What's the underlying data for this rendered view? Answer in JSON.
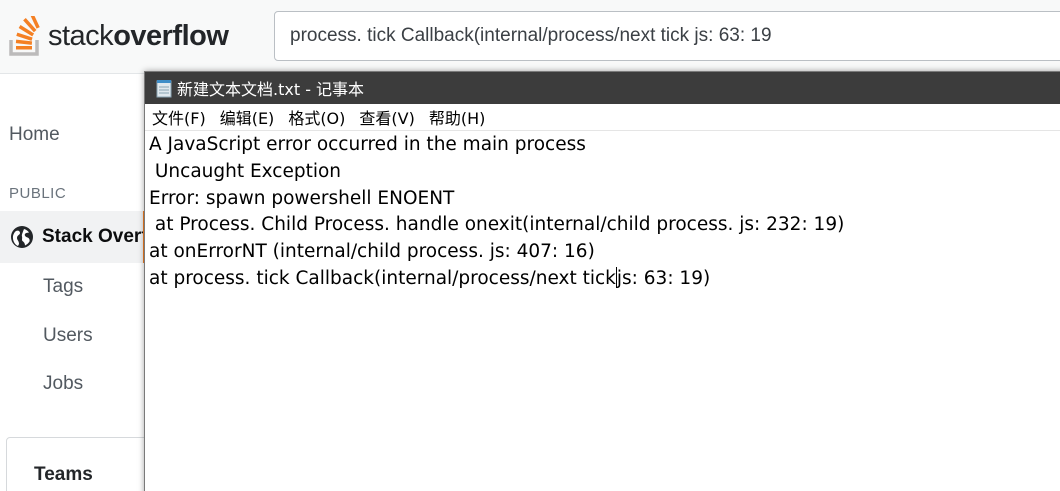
{
  "header": {
    "logo_text_light": "stack",
    "logo_text_bold": "overflow",
    "search_value": "process. tick Callback(internal/process/next tick js: 63: 19"
  },
  "sidebar": {
    "home": "Home",
    "section_public": "PUBLIC",
    "stack_overflow": "Stack Overflow",
    "tags": "Tags",
    "users": "Users",
    "jobs": "Jobs",
    "teams": "Teams"
  },
  "notepad": {
    "title": "新建文本文档.txt - 记事本",
    "menu": [
      "文件(F)",
      "编辑(E)",
      "格式(O)",
      "查看(V)",
      "帮助(H)"
    ],
    "lines": [
      "A JavaScript error occurred in the main process",
      " Uncaught Exception",
      "Error: spawn powershell ENOENT",
      " at Process. Child Process. handle onexit(internal/child process. js: 232: 19)",
      "at onErrorNT (internal/child process. js: 407: 16)"
    ],
    "last_line_before_caret": "at process. tick Callback(internal/process/next tick",
    "last_line_after_caret": "js: 63: 19)"
  },
  "colors": {
    "so_orange": "#f48024",
    "so_grey": "#bcbbbb",
    "titlebar": "#3c3c3c",
    "sidebar_selected_bg": "#f1f2f3"
  },
  "icons": {
    "logo": "stack-overflow-logo-icon",
    "globe": "globe-icon",
    "notepad": "notepad-icon"
  }
}
